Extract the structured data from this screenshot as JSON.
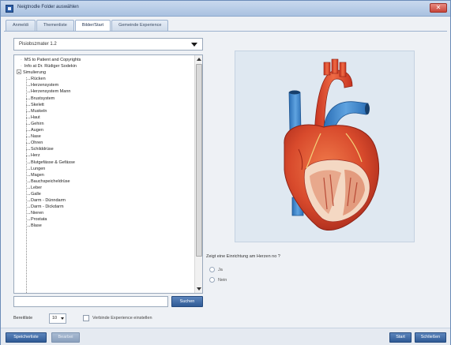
{
  "window": {
    "title": "Neigtnodle Folder auswählen",
    "close_label": "✕"
  },
  "tabs": [
    {
      "label": "Anmeldi",
      "active": false
    },
    {
      "label": "Themenliste",
      "active": false
    },
    {
      "label": "Bilder/Start",
      "active": true
    },
    {
      "label": "Gemeinde Experience",
      "active": false
    }
  ],
  "left_panel": {
    "dropdown_value": "Pisiobszmater 1.2",
    "tree": [
      {
        "label": "MS to Patient and Copyrights",
        "level": 0,
        "type": "leaf"
      },
      {
        "label": "Info at Dr. Rüdiger Sodekin",
        "level": 0,
        "type": "leaf"
      },
      {
        "label": "Simulierung",
        "level": 0,
        "type": "folder"
      },
      {
        "label": "Rücken",
        "level": 1
      },
      {
        "label": "Herzensystem",
        "level": 1
      },
      {
        "label": "Herzensystem Mann",
        "level": 1
      },
      {
        "label": "Brustsystem",
        "level": 1
      },
      {
        "label": "Skelett",
        "level": 1
      },
      {
        "label": "Muskeln",
        "level": 1
      },
      {
        "label": "Haut",
        "level": 1
      },
      {
        "label": "Gehirn",
        "level": 1
      },
      {
        "label": "Augen",
        "level": 1
      },
      {
        "label": "Nase",
        "level": 1
      },
      {
        "label": "Ohren",
        "level": 1
      },
      {
        "label": "Schilddrüse",
        "level": 1
      },
      {
        "label": "Herz",
        "level": 1
      },
      {
        "label": "Blutgefässe & Gefässe",
        "level": 1
      },
      {
        "label": "Lungen",
        "level": 1
      },
      {
        "label": "Magen",
        "level": 1
      },
      {
        "label": "Bauchspeicheldrüse",
        "level": 1
      },
      {
        "label": "Leber",
        "level": 1
      },
      {
        "label": "Galle",
        "level": 1
      },
      {
        "label": "Darm - Dünndarm",
        "level": 1
      },
      {
        "label": "Darm - Dickdarm",
        "level": 1
      },
      {
        "label": "Nieren",
        "level": 1
      },
      {
        "label": "Prostata",
        "level": 1
      },
      {
        "label": "Blase",
        "level": 1
      }
    ],
    "search_value": "",
    "search_button": "Suchen"
  },
  "status_bar": {
    "count_label": "Bereitliste",
    "count_value": "10",
    "checkbox_label": "Verbinde Experience einstellen"
  },
  "main": {
    "question": "Zeigt eine Einrichtung am Herzen no ?",
    "options": [
      "Ja",
      "Nein"
    ]
  },
  "bottom_bar": {
    "left_button_primary": "Speicherliste",
    "left_button_disabled": "Bearbei",
    "right_button_1": "Start",
    "right_button_2": "Schließen"
  },
  "colors": {
    "accent": "#2f5a95",
    "title_bar": "#b9cde7",
    "image_background": "#dfe8f1"
  }
}
